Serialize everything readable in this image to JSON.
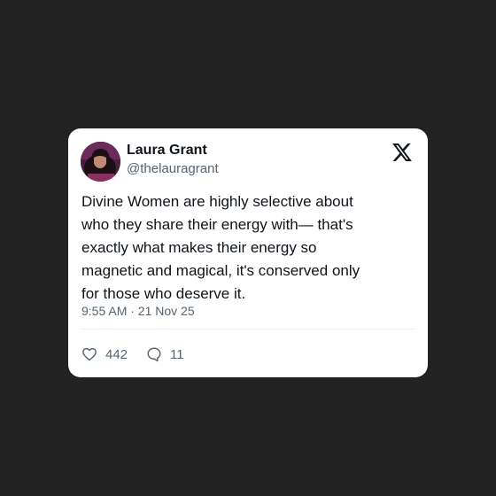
{
  "tweet": {
    "author": {
      "display_name": "Laura Grant",
      "handle": "@thelauragrant"
    },
    "text_lines": [
      "Divine Women are highly selective about",
      "who they share their energy with— that's",
      "exactly what makes their energy so",
      "magnetic and magical, it's conserved only",
      "for those who deserve it."
    ],
    "timestamp": "9:55 AM · 21 Nov 25",
    "likes": "442",
    "replies": "11",
    "platform_icon": "x-logo-icon"
  },
  "colors": {
    "background": "#222222",
    "card": "#ffffff",
    "text_primary": "#0f1419",
    "text_secondary": "#536471"
  }
}
